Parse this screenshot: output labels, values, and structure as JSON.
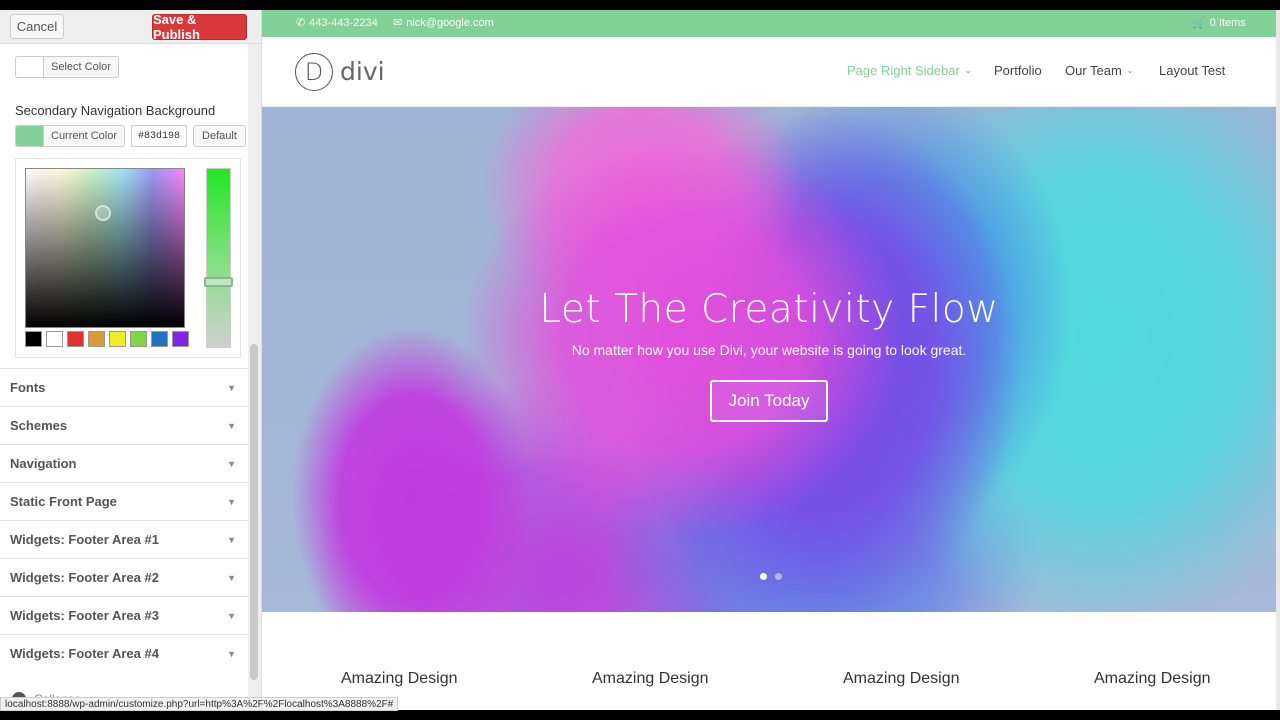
{
  "customizer": {
    "cancel_label": "Cancel",
    "publish_label": "Save & Publish",
    "prev_color": {
      "button_label": "Select Color",
      "swatch_color": "#ffffff"
    },
    "secondary_nav_bg": {
      "title": "Secondary Navigation Background",
      "current_label": "Current Color",
      "hex_value": "#83d198",
      "default_label": "Default",
      "swatch_color": "#83d198"
    },
    "palette": [
      "#000000",
      "#ffffff",
      "#dd3333",
      "#dd9933",
      "#eeee22",
      "#81d742",
      "#1e73be",
      "#8224e3"
    ],
    "sections": [
      {
        "label": "Fonts"
      },
      {
        "label": "Schemes"
      },
      {
        "label": "Navigation"
      },
      {
        "label": "Static Front Page"
      },
      {
        "label": "Widgets: Footer Area #1"
      },
      {
        "label": "Widgets: Footer Area #2"
      },
      {
        "label": "Widgets: Footer Area #3"
      },
      {
        "label": "Widgets: Footer Area #4"
      }
    ],
    "collapse_label": "Collapse"
  },
  "status_url": "localhost:8888/wp-admin/customize.php?url=http%3A%2F%2Flocalhost%3A8888%2F#",
  "site": {
    "topbar": {
      "phone": "443-443-2234",
      "email": "nick@google.com",
      "cart": "0 Items",
      "bg_color": "#83d198"
    },
    "logo_letter": "D",
    "logo_text": "divi",
    "nav": [
      {
        "label": "Page Right Sidebar",
        "has_caret": true,
        "active": true
      },
      {
        "label": "Portfolio",
        "has_caret": false
      },
      {
        "label": "Our Team",
        "has_caret": true
      },
      {
        "label": "Layout Test",
        "has_caret": false
      }
    ],
    "hero": {
      "title": "Let The Creativity Flow",
      "subtitle": "No matter how you use Divi, your website is going to look great.",
      "button": "Join Today"
    },
    "blurbs": [
      {
        "title": "Amazing Design"
      },
      {
        "title": "Amazing Design"
      },
      {
        "title": "Amazing Design"
      },
      {
        "title": "Amazing Design"
      }
    ]
  }
}
